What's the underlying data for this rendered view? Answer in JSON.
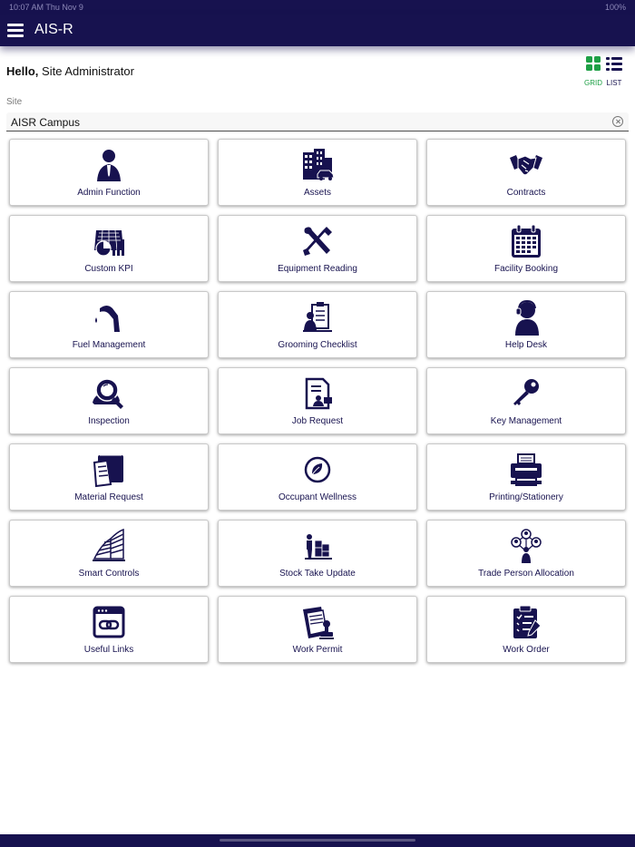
{
  "status_bar": {
    "time_date": "10:07 AM   Thu Nov 9",
    "battery": "100%"
  },
  "header": {
    "title": "AIS-R",
    "menu_icon": "hamburger-menu-icon"
  },
  "greeting": {
    "hello": "Hello,",
    "user": "Site Administrator"
  },
  "view_toggle": {
    "grid_label": "GRID",
    "list_label": "LIST",
    "active": "grid",
    "active_color": "#1fa046",
    "inactive_color": "#17124f"
  },
  "site": {
    "label": "Site",
    "value": "AISR Campus"
  },
  "colors": {
    "brand": "#17124f",
    "icon": "#17124f"
  },
  "tiles": [
    {
      "label": "Admin Function",
      "icon": "admin-user-icon"
    },
    {
      "label": "Assets",
      "icon": "buildings-icon"
    },
    {
      "label": "Contracts",
      "icon": "handshake-icon"
    },
    {
      "label": "Custom KPI",
      "icon": "kpi-chart-icon"
    },
    {
      "label": "Equipment Reading",
      "icon": "tools-icon"
    },
    {
      "label": "Facility Booking",
      "icon": "calendar-icon"
    },
    {
      "label": "Fuel Management",
      "icon": "fuel-nozzle-icon"
    },
    {
      "label": "Grooming Checklist",
      "icon": "checklist-person-icon"
    },
    {
      "label": "Help Desk",
      "icon": "headset-person-icon"
    },
    {
      "label": "Inspection",
      "icon": "magnifier-icon"
    },
    {
      "label": "Job Request",
      "icon": "job-document-icon"
    },
    {
      "label": "Key Management",
      "icon": "key-icon"
    },
    {
      "label": "Material Request",
      "icon": "box-documents-icon"
    },
    {
      "label": "Occupant Wellness",
      "icon": "leaf-circle-icon"
    },
    {
      "label": "Printing/Stationery",
      "icon": "printer-icon"
    },
    {
      "label": "Smart Controls",
      "icon": "smart-building-icon"
    },
    {
      "label": "Stock Take Update",
      "icon": "stock-boxes-icon"
    },
    {
      "label": "Trade Person Allocation",
      "icon": "people-network-icon"
    },
    {
      "label": "Useful Links",
      "icon": "browser-link-icon"
    },
    {
      "label": "Work Permit",
      "icon": "permit-stamp-icon"
    },
    {
      "label": "Work Order",
      "icon": "clipboard-pen-icon"
    }
  ]
}
